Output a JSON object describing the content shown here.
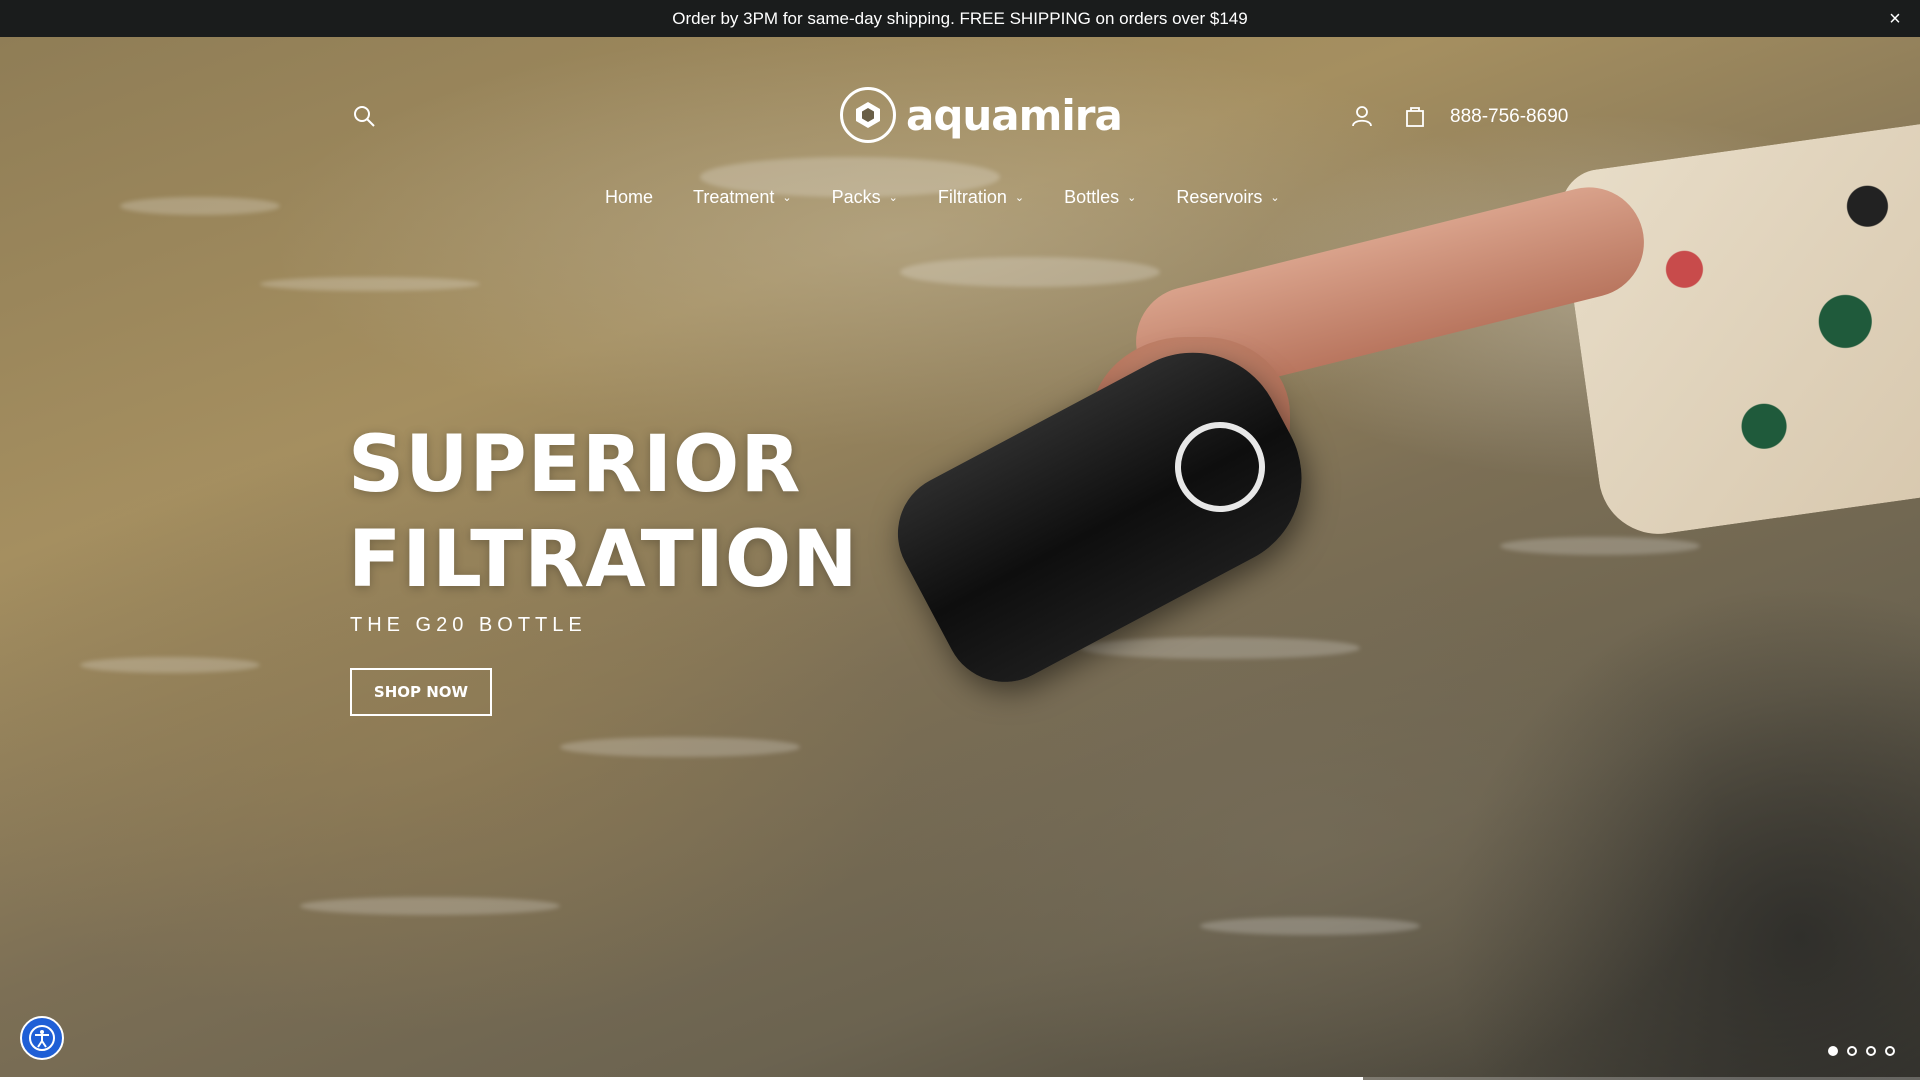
{
  "announcement": {
    "text": "Order by 3PM for same-day shipping. FREE SHIPPING on orders over $149",
    "close_label": "×"
  },
  "header": {
    "logo_text": "aquamira",
    "phone": "888-756-8690",
    "icons": [
      "search-icon",
      "account-icon",
      "cart-icon"
    ]
  },
  "nav": {
    "items": [
      {
        "label": "Home",
        "has_dropdown": false
      },
      {
        "label": "Treatment",
        "has_dropdown": true
      },
      {
        "label": "Packs",
        "has_dropdown": true
      },
      {
        "label": "Filtration",
        "has_dropdown": true
      },
      {
        "label": "Bottles",
        "has_dropdown": true
      },
      {
        "label": "Reservoirs",
        "has_dropdown": true
      }
    ],
    "chevron": "⌄"
  },
  "hero": {
    "headline_line1": "SUPERIOR",
    "headline_line2": "FILTRATION",
    "subheading": "THE G20 BOTTLE",
    "cta_label": "SHOP NOW",
    "slides_total": 4,
    "active_slide": 1,
    "progress_fraction": 0.71
  },
  "colors": {
    "announcement_bg": "#1a1c1c",
    "accessibility_blue": "#1f5fd6",
    "text": "#ffffff"
  }
}
